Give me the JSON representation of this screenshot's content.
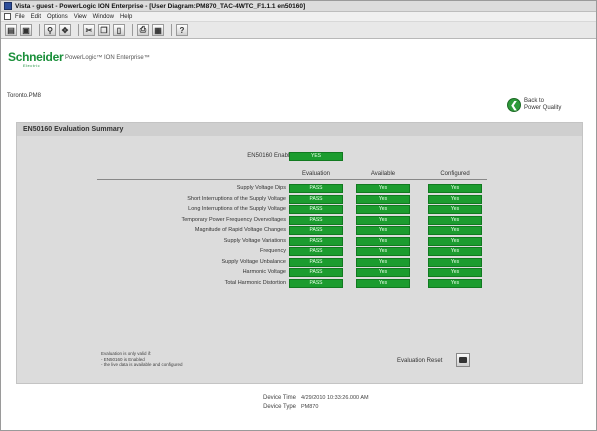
{
  "window": {
    "title": "Vista - guest - PowerLogic ION Enterprise - [User Diagram:PM870_TAC-4WTC_F1.1.1 en50160]"
  },
  "menubar": {
    "items": [
      "File",
      "Edit",
      "Options",
      "View",
      "Window",
      "Help"
    ]
  },
  "toolbar": {
    "buttons": [
      "open-icon",
      "save-icon",
      "zoom-icon",
      "move-icon",
      "cut-icon",
      "copy-icon",
      "paste-icon",
      "print-icon",
      "grid-icon",
      "help-icon"
    ]
  },
  "header": {
    "logo": "Schneider",
    "logo_sub": "Electric",
    "breadcrumb": "PowerLogic™ ION Enterprise™"
  },
  "page": {
    "device_name": "Toronto.PM8",
    "back_link": {
      "line1": "Back to",
      "line2": "Power Quality"
    }
  },
  "panel": {
    "title": "EN50160 Evaluation Summary",
    "enabled_label": "EN50160 Enabled",
    "enabled_value": "YES",
    "columns": [
      "Evaluation",
      "Available",
      "Configured"
    ],
    "rows": [
      {
        "label": "Supply Voltage Dips",
        "evaluation": "PASS",
        "available": "Yes",
        "configured": "Yes"
      },
      {
        "label": "Short Interruptions of the Supply Voltage",
        "evaluation": "PASS",
        "available": "Yes",
        "configured": "Yes"
      },
      {
        "label": "Long Interruptions of the Supply Voltage",
        "evaluation": "PASS",
        "available": "Yes",
        "configured": "Yes"
      },
      {
        "label": "Temporary Power Frequency Overvoltages",
        "evaluation": "PASS",
        "available": "Yes",
        "configured": "Yes"
      },
      {
        "label": "Magnitude of Rapid Voltage Changes",
        "evaluation": "PASS",
        "available": "Yes",
        "configured": "Yes"
      },
      {
        "label": "Supply Voltage Variations",
        "evaluation": "PASS",
        "available": "Yes",
        "configured": "Yes"
      },
      {
        "label": "Frequency",
        "evaluation": "PASS",
        "available": "Yes",
        "configured": "Yes"
      },
      {
        "label": "Supply Voltage Unbalance",
        "evaluation": "PASS",
        "available": "Yes",
        "configured": "Yes"
      },
      {
        "label": "Harmonic Voltage",
        "evaluation": "PASS",
        "available": "Yes",
        "configured": "Yes"
      },
      {
        "label": "Total Harmonic Distortion",
        "evaluation": "PASS",
        "available": "Yes",
        "configured": "Yes"
      }
    ],
    "note": {
      "line1": "Evaluation is only valid if:",
      "line2": "- EN50160 is Enabled",
      "line3": "- the live data is available and configured"
    },
    "reset_label": "Evaluation Reset"
  },
  "footer": {
    "device_time_label": "Device Time",
    "device_time_value": "4/29/2010 10:33:26.000 AM",
    "device_type_label": "Device Type",
    "device_type_value": "PM870"
  },
  "colors": {
    "pass_green": "#1c9c2f",
    "brand_green": "#1a8f3a",
    "panel_bg": "#dcdcdc"
  }
}
